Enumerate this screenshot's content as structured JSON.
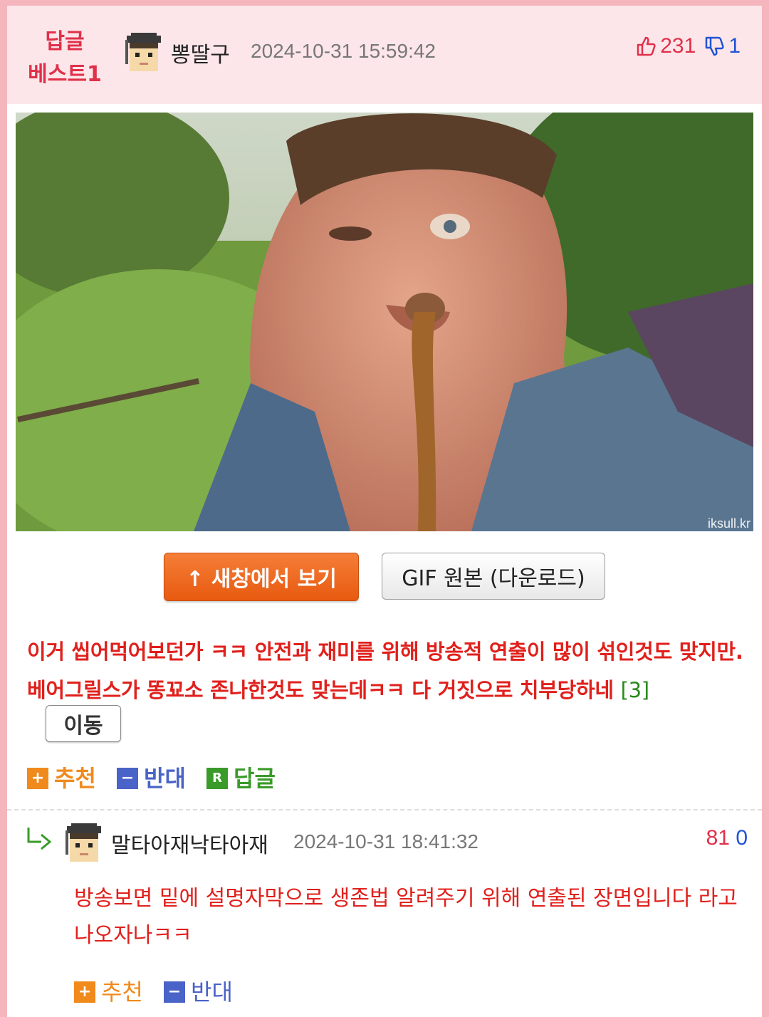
{
  "best_comment": {
    "badge_line1": "답글",
    "badge_line2": "베스트1",
    "nickname": "뽕딸구",
    "timestamp": "2024-10-31 15:59:42",
    "upvotes": "231",
    "downvotes": "1",
    "media_watermark": "iksull.kr",
    "open_new_window_label": "↑ 새창에서 보기",
    "gif_original_label": "GIF 원본 (다운로드)",
    "text": "이거 씹어먹어보던가 ㅋㅋ 안전과 재미를 위해 방송적 연출이 많이 섞인것도 맞지만. 베어그릴스가 똥꾜소 존나한것도 맞는데ㅋㅋ 다 거짓으로 치부당하네",
    "reply_count": "[3]",
    "move_label": "이동",
    "actions": {
      "recommend_icon": "+",
      "recommend_label": "추천",
      "oppose_icon": "−",
      "oppose_label": "반대",
      "reply_icon": "R",
      "reply_label": "답글"
    }
  },
  "reply": {
    "nickname": "말타아재낙타아재",
    "timestamp": "2024-10-31 18:41:32",
    "upvotes": "81",
    "downvotes": "0",
    "text": "방송보면 밑에 설명자막으로 생존법 알려주기 위해 연출된 장면입니다 라고 나오자나ㅋㅋ",
    "actions": {
      "recommend_icon": "+",
      "recommend_label": "추천",
      "oppose_icon": "−",
      "oppose_label": "반대"
    }
  },
  "colors": {
    "page_border": "#f4b5bd",
    "header_bg": "#fde6e9",
    "accent_red": "#e0201c",
    "up_red": "#e0304a",
    "down_blue": "#1f53d6",
    "orange": "#f08a1c",
    "green": "#3a9a2a"
  },
  "icons": [
    "avatar-icon",
    "thumbs-up-icon",
    "thumbs-down-icon",
    "reply-arrow-icon",
    "plus-icon",
    "minus-icon",
    "reply-r-icon"
  ]
}
